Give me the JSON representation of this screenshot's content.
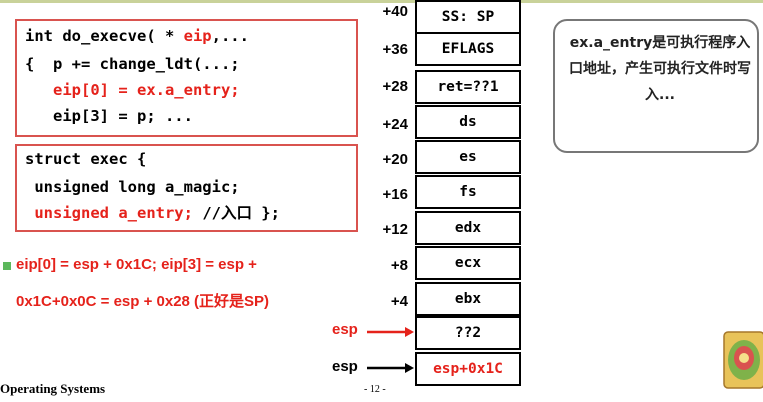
{
  "code_box_1": {
    "line1_a": "int do_execve( * ",
    "line1_b": "eip",
    "line1_c": ",...",
    "line2": "{  p += change_ldt(...;",
    "line3": "   eip[0] = ex.a_entry;",
    "line4": "   eip[3] = p; ..."
  },
  "code_box_2": {
    "line1": "struct exec {",
    "line2": " unsigned long a_magic;",
    "line3_a": " unsigned a_entry; ",
    "line3_b": "//入口 };"
  },
  "bullet": {
    "line1": "eip[0] = esp + 0x1C; eip[3] = esp +",
    "line2": "0x1C+0x0C = esp + 0x28 (正好是SP)"
  },
  "stack": {
    "cells": [
      "SS: SP",
      "EFLAGS",
      "ret=??1",
      "ds",
      "es",
      "fs",
      "edx",
      "ecx",
      "ebx",
      "??2",
      "esp+0x1C"
    ],
    "offsets": [
      "+40",
      "+36",
      "+28",
      "+24",
      "+20",
      "+16",
      "+12",
      "+8",
      "+4"
    ]
  },
  "esp_labels": [
    "esp",
    "esp"
  ],
  "callout": {
    "text": "ex.a_entry是可执行程序入口地址，产生可执行文件时写入..."
  },
  "footer": {
    "left": "Operating Systems",
    "page": "- 12 -"
  },
  "colors": {
    "accent_red": "#e5221b",
    "box_border": "#d9534f",
    "bullet_green": "#5cb85c"
  },
  "icons": {
    "logo": "operating-systems-logo"
  }
}
